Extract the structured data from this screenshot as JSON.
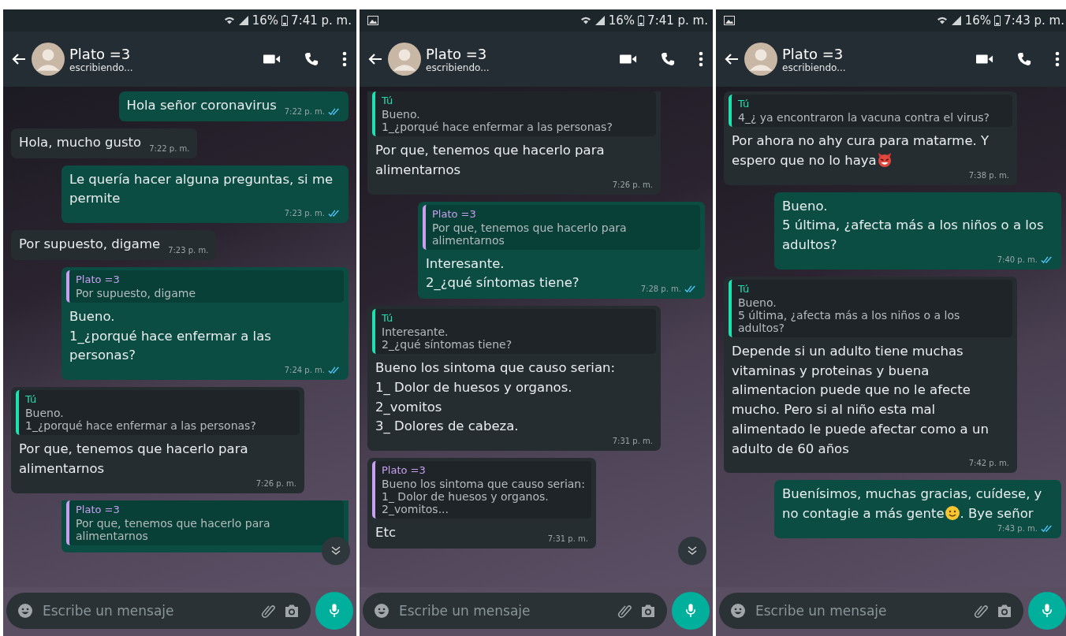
{
  "screens": [
    {
      "status": {
        "notification_icon": false,
        "battery": "16%",
        "time": "7:41 p. m."
      },
      "header": {
        "name": "Plato =3",
        "subtitle": "escribiendo..."
      },
      "scroll_button": true,
      "composer": {
        "placeholder": "Escribe un mensaje"
      },
      "messages": [
        {
          "kind": "sent",
          "text": "Hola señor coronavirus",
          "time": "7:22 p. m.",
          "read": true
        },
        {
          "kind": "received",
          "text": "Hola, mucho gusto",
          "time": "7:22 p. m."
        },
        {
          "kind": "sent",
          "text": "Le quería hacer alguna preguntas, si me permite",
          "time": "7:23 p. m.",
          "read": true
        },
        {
          "kind": "received",
          "text": "Por supuesto, digame",
          "time": "7:23 p. m."
        },
        {
          "kind": "sent",
          "quote": {
            "author": "Plato =3",
            "kind": "contact",
            "text": "Por supuesto, digame"
          },
          "text": "Bueno.\n1_¿porqué hace enfermar a las personas?",
          "time": "7:24 p. m.",
          "read": true
        },
        {
          "kind": "received",
          "quote": {
            "author": "Tú",
            "kind": "self",
            "text": "Bueno.\n1_¿porqué hace enfermar a las personas?"
          },
          "text": "Por que, tenemos que hacerlo para alimentarnos",
          "time": "7:26 p. m."
        },
        {
          "kind": "sent",
          "cut": true,
          "quote": {
            "author": "Plato =3",
            "kind": "contact",
            "text": "Por que, tenemos que hacerlo para alimentarnos"
          }
        }
      ]
    },
    {
      "status": {
        "notification_icon": true,
        "battery": "16%",
        "time": "7:41 p. m."
      },
      "header": {
        "name": "Plato =3",
        "subtitle": "escribiendo..."
      },
      "scroll_button": true,
      "composer": {
        "placeholder": "Escribe un mensaje"
      },
      "messages": [
        {
          "kind": "received",
          "cut": true,
          "quote": {
            "author": "Tú",
            "kind": "self",
            "text": "Bueno.\n1_¿porqué hace enfermar a las personas?"
          },
          "text": "Por que, tenemos que hacerlo para alimentarnos",
          "time": "7:26 p. m."
        },
        {
          "kind": "sent",
          "quote": {
            "author": "Plato =3",
            "kind": "contact",
            "text": "Por que, tenemos que hacerlo para alimentarnos"
          },
          "text": "Interesante.\n2_¿qué síntomas tiene?",
          "time": "7:28 p. m.",
          "read": true
        },
        {
          "kind": "received",
          "quote": {
            "author": "Tú",
            "kind": "self",
            "text": "Interesante.\n2_¿qué síntomas tiene?"
          },
          "text": "Bueno los sintoma que causo serian:\n1_ Dolor de huesos y organos.\n2_vomitos\n3_ Dolores de cabeza.",
          "time": "7:31 p. m."
        },
        {
          "kind": "received",
          "quote": {
            "author": "Plato =3",
            "kind": "contact",
            "text": "Bueno los sintoma que causo serian:\n1_ Dolor de huesos y organos.\n2_vomitos..."
          },
          "text": "Etc",
          "time": "7:31 p. m."
        }
      ]
    },
    {
      "status": {
        "notification_icon": true,
        "battery": "16%",
        "time": "7:43 p. m."
      },
      "header": {
        "name": "Plato =3",
        "subtitle": "escribiendo..."
      },
      "scroll_button": false,
      "composer": {
        "placeholder": "Escribe un mensaje"
      },
      "messages": [
        {
          "kind": "received",
          "quote": {
            "author": "Tú",
            "kind": "self",
            "text": "4_¿ ya encontraron la vacuna contra el virus?"
          },
          "text": "Por ahora no ahy cura para matarme. Y espero que no lo haya",
          "emoji": {
            "kind": "devil"
          },
          "time": "7:38 p. m."
        },
        {
          "kind": "sent",
          "text": "Bueno.\n5 última, ¿afecta más a los niños o a los adultos?",
          "time": "7:40 p. m.",
          "read": true
        },
        {
          "kind": "received",
          "quote": {
            "author": "Tú",
            "kind": "self",
            "text": "Bueno.\n5 última, ¿afecta más a los niños o a los adultos?"
          },
          "text": "Depende si un adulto tiene muchas vitaminas y proteinas y buena alimentacion puede que no le afecte mucho. Pero si al niño esta mal alimentado le puede afectar como a un adulto de 60 años",
          "time": "7:42 p. m."
        },
        {
          "kind": "sent",
          "text": "Buenísimos, muchas gracias, cuídese, y no contagie a más gente",
          "emoji": {
            "kind": "smiley"
          },
          "text_after": ". Bye señor",
          "time": "7:43 p. m.",
          "read": true
        }
      ]
    }
  ]
}
